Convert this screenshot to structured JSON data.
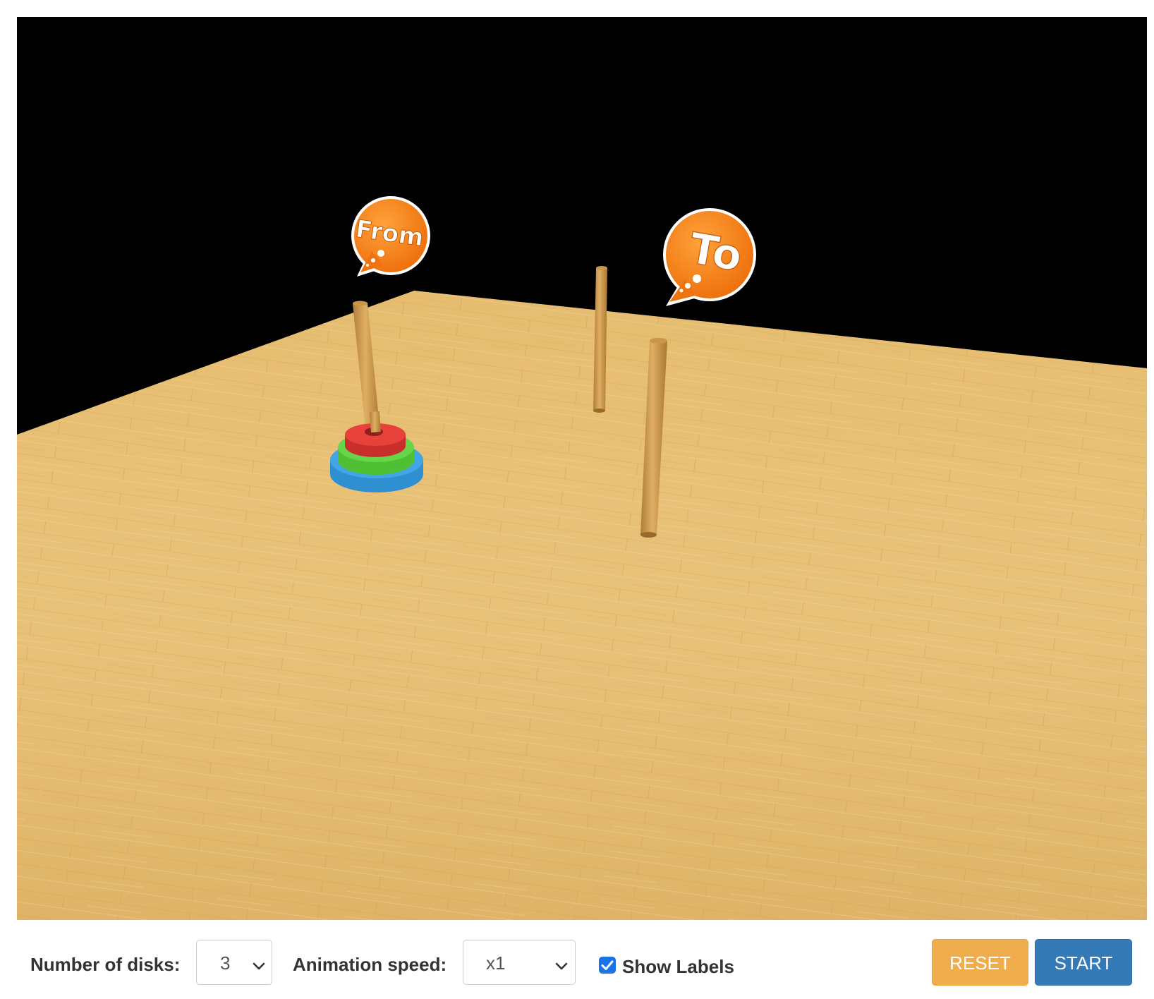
{
  "scene": {
    "background_color": "#000000",
    "floor_color": "#e3b86a",
    "labels": {
      "from": "From",
      "to": "To"
    },
    "label_color": "#f27a12",
    "disk_colors": {
      "small": "#e8413c",
      "medium": "#67d54a",
      "large": "#41a6e5"
    }
  },
  "controls": {
    "disks_label": "Number of disks:",
    "disks_value": "3",
    "speed_label": "Animation speed:",
    "speed_value": "x1",
    "show_labels_label": "Show Labels",
    "show_labels_checked": true,
    "reset_label": "RESET",
    "start_label": "START"
  },
  "colors": {
    "reset": "#f0ad4e",
    "start": "#337ab7",
    "checkbox": "#1a73e8"
  }
}
